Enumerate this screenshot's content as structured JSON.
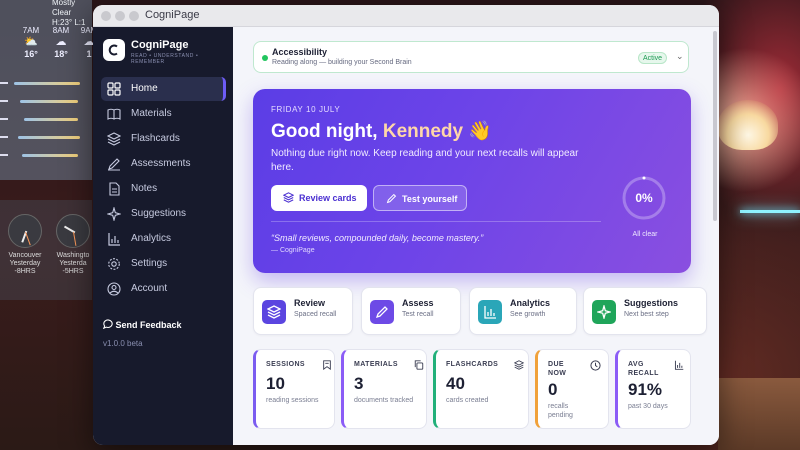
{
  "window": {
    "title": "CogniPage"
  },
  "weather": {
    "condition": "Mostly Clear",
    "hilo": "H:23° L:1",
    "hours": [
      {
        "time": "7AM",
        "temp": "16°",
        "icon": "sun-cloud-icon"
      },
      {
        "time": "8AM",
        "temp": "18°",
        "icon": "cloud-icon"
      },
      {
        "time": "9AM",
        "temp": "1",
        "icon": "cloud-icon"
      }
    ]
  },
  "clocks": [
    {
      "city": "Vancouver",
      "day": "Yesterday",
      "offset": "-8HRS"
    },
    {
      "city": "Washingto",
      "day": "Yesterda",
      "offset": "-5HRS"
    }
  ],
  "sidebar": {
    "brand": "CogniPage",
    "tagline": "READ • UNDERSTAND • REMEMBER",
    "items": [
      {
        "label": "Home",
        "icon": "grid-icon"
      },
      {
        "label": "Materials",
        "icon": "book-icon"
      },
      {
        "label": "Flashcards",
        "icon": "layers-icon"
      },
      {
        "label": "Assessments",
        "icon": "pencil-icon"
      },
      {
        "label": "Notes",
        "icon": "document-icon"
      },
      {
        "label": "Suggestions",
        "icon": "sparkle-icon"
      },
      {
        "label": "Analytics",
        "icon": "bar-chart-icon"
      },
      {
        "label": "Settings",
        "icon": "gear-icon"
      },
      {
        "label": "Account",
        "icon": "user-icon"
      }
    ],
    "feedback": "Send Feedback",
    "version": "v1.0.0 beta"
  },
  "accessibility": {
    "title": "Accessibility",
    "subtitle": "Reading along — building your Second Brain",
    "badge": "Active"
  },
  "hero": {
    "date": "FRIDAY 10 JULY",
    "greeting": "Good night,",
    "name": "Kennedy",
    "emoji": "👋",
    "message": "Nothing due right now. Keep reading and your next recalls will appear here.",
    "review_label": "Review cards",
    "test_label": "Test yourself",
    "quote": "“Small reviews, compounded daily, become mastery.”",
    "quote_source": "— CogniPage",
    "progress_value": "0%",
    "progress_fraction": 0,
    "progress_label": "All clear"
  },
  "quick_actions": [
    {
      "title": "Review",
      "subtitle": "Spaced recall",
      "color": "#5b45e0",
      "icon": "layers-icon"
    },
    {
      "title": "Assess",
      "subtitle": "Test recall",
      "color": "#6d4ae6",
      "icon": "pencil-icon"
    },
    {
      "title": "Analytics",
      "subtitle": "See growth",
      "color": "#2aa6b8",
      "icon": "bar-chart-icon"
    },
    {
      "title": "Suggestions",
      "subtitle": "Next best step",
      "color": "#1fa55a",
      "icon": "sparkle-icon"
    }
  ],
  "stats": [
    {
      "label": "SESSIONS",
      "value": "10",
      "sub": "reading sessions",
      "accent": "#7b5cf0",
      "icon": "bookmark-icon"
    },
    {
      "label": "MATERIALS",
      "value": "3",
      "sub": "documents tracked",
      "accent": "#8b5cf6",
      "icon": "copy-icon"
    },
    {
      "label": "FLASHCARDS",
      "value": "40",
      "sub": "cards created",
      "accent": "#22b07a",
      "icon": "layers-icon"
    },
    {
      "label": "DUE NOW",
      "value": "0",
      "sub": "recalls pending",
      "accent": "#f0a13a",
      "icon": "clock-icon"
    },
    {
      "label": "AVG RECALL",
      "value": "91%",
      "sub": "past 30 days",
      "accent": "#8b5cf6",
      "icon": "bar-chart-icon"
    }
  ]
}
